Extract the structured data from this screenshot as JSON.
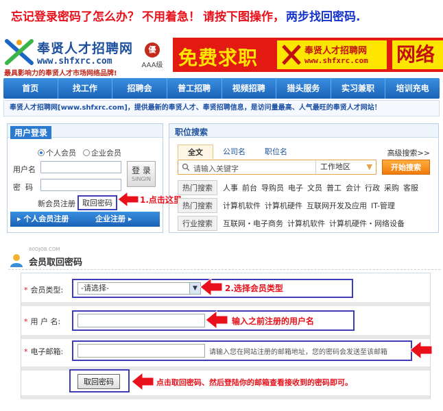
{
  "banner": {
    "part1": "忘记登录密码了怎么办？",
    "part2": "不用着急！",
    "part3": "请按下图操作，",
    "part4": "两步找回密码."
  },
  "logo": {
    "title": "奉贤人才招聘网",
    "url": "www.shfxrc.com",
    "slogan": "最具影响力的奉贤人才市场网络品牌!",
    "badge_seal": "優",
    "badge_text": "AAA级"
  },
  "ad": {
    "big_text": "免费求职",
    "mid_title": "奉贤人才招聘网",
    "mid_url": "www.shfxrc.com",
    "right_text": "网络"
  },
  "nav": [
    "首页",
    "找工作",
    "招聘会",
    "普工招聘",
    "视频招聘",
    "猎头服务",
    "实习兼职",
    "培训充电"
  ],
  "tagline": "奉贤人才招聘网[www.shfxrc.com]，提供最新的奉贤人才、奉贤招聘信息，是访问量最高、人气最旺的奉贤人才网站！",
  "login": {
    "title": "用户登录",
    "radio_personal": "个人会员",
    "radio_company": "企业会员",
    "username_label": "用户名",
    "password_label": "密  码",
    "login_button": "登 录",
    "login_button_sub": "SINGIN",
    "register_link": "新会员注册",
    "retrieve_link": "取回密码",
    "personal_register": "个人会员注册",
    "company_register": "企业注册"
  },
  "annotation1": "1.点击这里",
  "search": {
    "title": "职位搜索",
    "tabs": [
      "全文",
      "公司名",
      "职位名"
    ],
    "advanced": "高级搜索>>",
    "placeholder": "请输入关键字",
    "area": "工作地区",
    "button": "开始搜索",
    "rows": [
      {
        "tag": "热门搜索",
        "keywords": [
          "人事",
          "前台",
          "导购员",
          "电子",
          "文员",
          "普工",
          "会计",
          "行政",
          "采购",
          "客服"
        ]
      },
      {
        "tag": "热门搜索",
        "keywords": [
          "计算机软件",
          "计算机硬件",
          "互联网开发及应用",
          "IT-管理"
        ]
      },
      {
        "tag": "行业搜索",
        "keywords": [
          "互联网・电子商务",
          "计算机软件",
          "计算机硬件・网络设备"
        ]
      }
    ]
  },
  "retrieve": {
    "small": "80OJOB.COM",
    "title": "会员取回密码",
    "member_type_label": "会员类型:",
    "member_type_value": "-请选择-",
    "username_label": "用 户 名:",
    "email_label": "电子邮箱:",
    "email_hint": "请输入您在网站注册的邮箱地址，您的密码会发送至该邮箱",
    "submit": "取回密码"
  },
  "annotations": {
    "step2": "2.选择会员类型",
    "username": "输入之前注册的用户名",
    "final": "点击取回密码、然后登陆你的邮箱查看接收到的密码即可。"
  },
  "colors": {
    "accent_red": "#e8101a",
    "accent_blue": "#1533c8",
    "nav_blue": "#1a62b8"
  }
}
